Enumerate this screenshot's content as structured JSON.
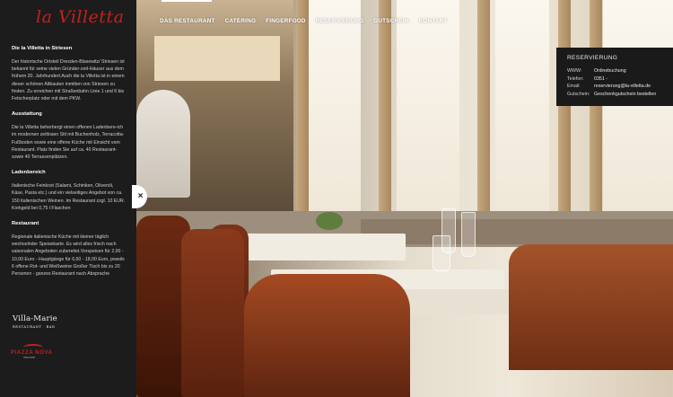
{
  "brand": {
    "logo_text": "la Villetta"
  },
  "nav": {
    "items": [
      {
        "label": "DAS RESTAURANT",
        "active": true
      },
      {
        "label": "CATERING",
        "active": false
      },
      {
        "label": "FINGERFOOD",
        "active": false
      },
      {
        "label": "RESERVIERUNG",
        "active": false
      },
      {
        "label": "GUTSCHEIN",
        "active": false
      },
      {
        "label": "KONTAKT",
        "active": false
      }
    ]
  },
  "sidebar": {
    "sections": [
      {
        "title": "Die la Villetta in Striesen",
        "text": "Der historische Ortsteil Dresden-Blasewitz/ Striesen ist bekannt für seine vielen Gründer-zeit-Häuser aus dem frühem 20. Jahrhundert.Auch die la Villetta ist in einem dieser schönen Altbauten inmitten von Striesen zu finden. Zu erreichen mit Straßenbahn Linie 1 und 6 bis Fetscherplatz oder mit dem PKW."
      },
      {
        "title": "Ausstattung",
        "text": "Die la Villetta beherbergt einen offenen Ladenbere-ich im modernen zeitlosen Stil mit Buchenholz, Terracotta-Fußboden sowie eine offene Küche mit Einsicht vom Restaurant. Platz finden Sie auf ca. 40 Restaurant- sowie 40 Terrassenplätzen."
      },
      {
        "title": "Ladenbereich",
        "text": "Italienische Feinkost (Salami, Schinken, Olivenöl, Käse, Pasta etc.) und ein vielseitiges Angebot von ca. 150 italienischen Weinen. Im Restaurant zzgl. 10 EUR. Korkgeld bei 0,75 l Flaschen"
      },
      {
        "title": "Restaurant",
        "text": "Regionale italienische Küche mit kleiner täglich wechselnder Speisekarte. Es wird alles frisch nach saisonalen Angeboten zubereitet.Vorspeisen für 2,00 - 10,00 Euro - Hauptgänge für 6,60 - 18,00 Euro, jeweils 6 offene Rot- und Weißweine Großer Tisch bis zu 20 Personen - ganzes Restaurant nach Absprache"
      }
    ],
    "close_label": "×",
    "partner_logos": {
      "villa_marie_name": "Villa-Marie",
      "villa_marie_sub": "RESTAURANT · BAR",
      "piazza_name": "PIAZZA NOVA",
      "piazza_sub": "ristorante"
    }
  },
  "reservation": {
    "title": "RESERVIERUNG",
    "rows": [
      {
        "label": "WWW:",
        "value": "Onlinebuchung"
      },
      {
        "label": "Telefon:",
        "value": "0351 -"
      },
      {
        "label": "Email:",
        "value": "reservierung@la-villetta.de"
      },
      {
        "label": "Gutschein:",
        "value": "Geschenkgutschein bestellen"
      }
    ]
  },
  "colors": {
    "brand_red": "#c4201d",
    "sidebar_bg": "#1c1c1c"
  }
}
